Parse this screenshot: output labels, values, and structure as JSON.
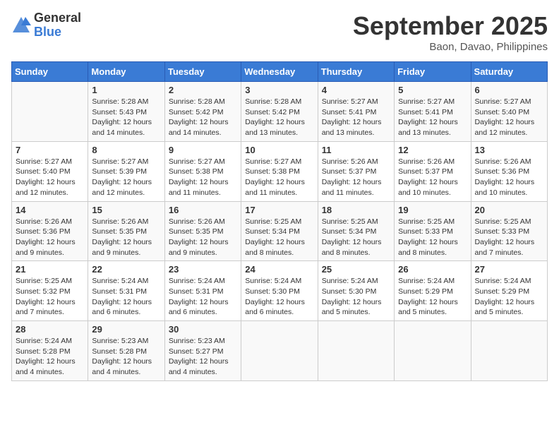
{
  "header": {
    "logo_general": "General",
    "logo_blue": "Blue",
    "month_title": "September 2025",
    "location": "Baon, Davao, Philippines"
  },
  "weekdays": [
    "Sunday",
    "Monday",
    "Tuesday",
    "Wednesday",
    "Thursday",
    "Friday",
    "Saturday"
  ],
  "weeks": [
    [
      {
        "day": "",
        "info": ""
      },
      {
        "day": "1",
        "info": "Sunrise: 5:28 AM\nSunset: 5:43 PM\nDaylight: 12 hours\nand 14 minutes."
      },
      {
        "day": "2",
        "info": "Sunrise: 5:28 AM\nSunset: 5:42 PM\nDaylight: 12 hours\nand 14 minutes."
      },
      {
        "day": "3",
        "info": "Sunrise: 5:28 AM\nSunset: 5:42 PM\nDaylight: 12 hours\nand 13 minutes."
      },
      {
        "day": "4",
        "info": "Sunrise: 5:27 AM\nSunset: 5:41 PM\nDaylight: 12 hours\nand 13 minutes."
      },
      {
        "day": "5",
        "info": "Sunrise: 5:27 AM\nSunset: 5:41 PM\nDaylight: 12 hours\nand 13 minutes."
      },
      {
        "day": "6",
        "info": "Sunrise: 5:27 AM\nSunset: 5:40 PM\nDaylight: 12 hours\nand 12 minutes."
      }
    ],
    [
      {
        "day": "7",
        "info": "Sunrise: 5:27 AM\nSunset: 5:40 PM\nDaylight: 12 hours\nand 12 minutes."
      },
      {
        "day": "8",
        "info": "Sunrise: 5:27 AM\nSunset: 5:39 PM\nDaylight: 12 hours\nand 12 minutes."
      },
      {
        "day": "9",
        "info": "Sunrise: 5:27 AM\nSunset: 5:38 PM\nDaylight: 12 hours\nand 11 minutes."
      },
      {
        "day": "10",
        "info": "Sunrise: 5:27 AM\nSunset: 5:38 PM\nDaylight: 12 hours\nand 11 minutes."
      },
      {
        "day": "11",
        "info": "Sunrise: 5:26 AM\nSunset: 5:37 PM\nDaylight: 12 hours\nand 11 minutes."
      },
      {
        "day": "12",
        "info": "Sunrise: 5:26 AM\nSunset: 5:37 PM\nDaylight: 12 hours\nand 10 minutes."
      },
      {
        "day": "13",
        "info": "Sunrise: 5:26 AM\nSunset: 5:36 PM\nDaylight: 12 hours\nand 10 minutes."
      }
    ],
    [
      {
        "day": "14",
        "info": "Sunrise: 5:26 AM\nSunset: 5:36 PM\nDaylight: 12 hours\nand 9 minutes."
      },
      {
        "day": "15",
        "info": "Sunrise: 5:26 AM\nSunset: 5:35 PM\nDaylight: 12 hours\nand 9 minutes."
      },
      {
        "day": "16",
        "info": "Sunrise: 5:26 AM\nSunset: 5:35 PM\nDaylight: 12 hours\nand 9 minutes."
      },
      {
        "day": "17",
        "info": "Sunrise: 5:25 AM\nSunset: 5:34 PM\nDaylight: 12 hours\nand 8 minutes."
      },
      {
        "day": "18",
        "info": "Sunrise: 5:25 AM\nSunset: 5:34 PM\nDaylight: 12 hours\nand 8 minutes."
      },
      {
        "day": "19",
        "info": "Sunrise: 5:25 AM\nSunset: 5:33 PM\nDaylight: 12 hours\nand 8 minutes."
      },
      {
        "day": "20",
        "info": "Sunrise: 5:25 AM\nSunset: 5:33 PM\nDaylight: 12 hours\nand 7 minutes."
      }
    ],
    [
      {
        "day": "21",
        "info": "Sunrise: 5:25 AM\nSunset: 5:32 PM\nDaylight: 12 hours\nand 7 minutes."
      },
      {
        "day": "22",
        "info": "Sunrise: 5:24 AM\nSunset: 5:31 PM\nDaylight: 12 hours\nand 6 minutes."
      },
      {
        "day": "23",
        "info": "Sunrise: 5:24 AM\nSunset: 5:31 PM\nDaylight: 12 hours\nand 6 minutes."
      },
      {
        "day": "24",
        "info": "Sunrise: 5:24 AM\nSunset: 5:30 PM\nDaylight: 12 hours\nand 6 minutes."
      },
      {
        "day": "25",
        "info": "Sunrise: 5:24 AM\nSunset: 5:30 PM\nDaylight: 12 hours\nand 5 minutes."
      },
      {
        "day": "26",
        "info": "Sunrise: 5:24 AM\nSunset: 5:29 PM\nDaylight: 12 hours\nand 5 minutes."
      },
      {
        "day": "27",
        "info": "Sunrise: 5:24 AM\nSunset: 5:29 PM\nDaylight: 12 hours\nand 5 minutes."
      }
    ],
    [
      {
        "day": "28",
        "info": "Sunrise: 5:24 AM\nSunset: 5:28 PM\nDaylight: 12 hours\nand 4 minutes."
      },
      {
        "day": "29",
        "info": "Sunrise: 5:23 AM\nSunset: 5:28 PM\nDaylight: 12 hours\nand 4 minutes."
      },
      {
        "day": "30",
        "info": "Sunrise: 5:23 AM\nSunset: 5:27 PM\nDaylight: 12 hours\nand 4 minutes."
      },
      {
        "day": "",
        "info": ""
      },
      {
        "day": "",
        "info": ""
      },
      {
        "day": "",
        "info": ""
      },
      {
        "day": "",
        "info": ""
      }
    ]
  ]
}
